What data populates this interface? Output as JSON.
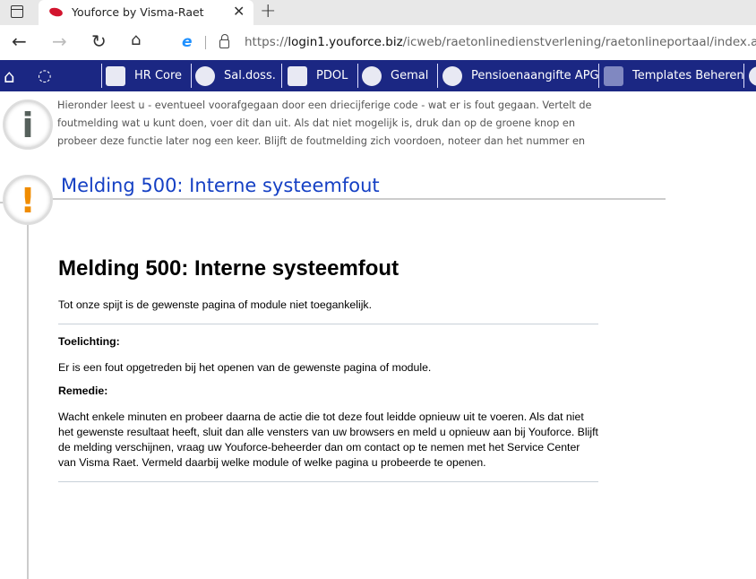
{
  "browser": {
    "tab_title": "Youforce by Visma-Raet",
    "url_prefix": "https://",
    "url_host": "login1.youforce.biz",
    "url_path": "/icweb/raetonlinedienstverlening/raetonlineportaal/index.aspx"
  },
  "nav": {
    "items": [
      {
        "label": "HR Core"
      },
      {
        "label": "Sal.doss."
      },
      {
        "label": "PDOL"
      },
      {
        "label": "Gemal"
      },
      {
        "label": "Pensioenaangifte APG"
      },
      {
        "label": "Templates Beheren"
      }
    ]
  },
  "info_text": "Hieronder leest u - eventueel voorafgegaan door een driecijferige code - wat er is fout gegaan. Vertelt de foutmelding wat u kunt doen, voer dit dan uit. Als dat niet mogelijk is, druk dan op de groene knop en probeer deze functie later nog een keer. Blijft de foutmelding zich voordoen, noteer dan het nummer en neem contact op met uw",
  "message": {
    "header": "Melding 500: Interne systeemfout",
    "title": "Melding 500: Interne systeemfout",
    "intro": "Tot onze spijt is de gewenste pagina of module niet toegankelijk.",
    "toelichting_label": "Toelichting:",
    "toelichting": "Er is een fout opgetreden bij het openen van de gewenste pagina of module.",
    "remedie_label": "Remedie:",
    "remedie": "Wacht enkele minuten en probeer daarna de actie die tot deze fout leidde opnieuw uit te voeren. Als dat niet het gewenste resultaat heeft, sluit dan alle vensters van uw browsers en meld u opnieuw aan bij Youforce. Blijft de melding verschijnen, vraag uw Youforce-beheerder dan om contact op te nemen met het Service Center van Visma Raet. Vermeld daarbij welke module of welke pagina u probeerde te openen."
  }
}
